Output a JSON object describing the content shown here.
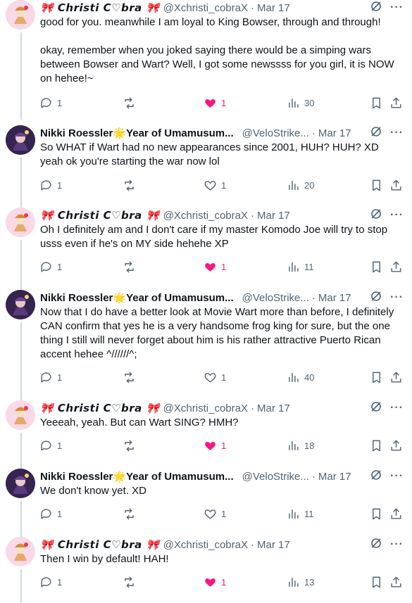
{
  "users": {
    "christi": {
      "name": "🎀 𝘾𝙝𝙧𝙞𝙨𝙩𝙞 𝘾♡𝙗𝙧𝙖 🎀",
      "handle": "@Xchristi_cobraX"
    },
    "nikki": {
      "name": "Nikki Roessler🌟Year of Umamusum...",
      "handle": "@VeloStrike..."
    }
  },
  "separator": "·",
  "tweets": [
    {
      "user": "christi",
      "date": "Mar 17",
      "text": "good for you. meanwhile I am loyal to King Bowser, through and through!\n\nokay, remember when you joked saying there would be a simping wars between Bowser and Wart? Well, I got some newssss for you girl, it is NOW on hehee!~",
      "replies": "1",
      "retweets": "",
      "likes": "1",
      "liked": true,
      "views": "30"
    },
    {
      "user": "nikki",
      "date": "Mar 17",
      "text": "So WHAT if Wart had no new appearances since 2001, HUH? HUH? XD\nyeah ok you're starting the war now lol",
      "replies": "1",
      "retweets": "",
      "likes": "1",
      "liked": false,
      "views": "20"
    },
    {
      "user": "christi",
      "date": "Mar 17",
      "text": "Oh I definitely am and I don't care if my master Komodo Joe will try to stop usss even if he's on MY side hehehe XP",
      "replies": "1",
      "retweets": "",
      "likes": "1",
      "liked": true,
      "views": "11"
    },
    {
      "user": "nikki",
      "date": "Mar 17",
      "text": "Now that I do have a better look at Movie Wart more than before, I definitely CAN confirm that yes he is a very handsome frog king for sure, but the one thing I still will never forget about him is his rather attractive Puerto Rican accent hehee ^//////^;",
      "replies": "1",
      "retweets": "",
      "likes": "1",
      "liked": false,
      "views": "40"
    },
    {
      "user": "christi",
      "date": "Mar 17",
      "text": "Yeeeah, yeah. But can Wart SING? HMH?",
      "replies": "1",
      "retweets": "",
      "likes": "1",
      "liked": true,
      "views": "18"
    },
    {
      "user": "nikki",
      "date": "Mar 17",
      "text": "We don't know yet. XD",
      "replies": "1",
      "retweets": "",
      "likes": "1",
      "liked": false,
      "views": "11"
    },
    {
      "user": "christi",
      "date": "Mar 17",
      "text": "Then I win by default! HAH!",
      "replies": "1",
      "retweets": "",
      "likes": "1",
      "liked": true,
      "views": "13"
    }
  ],
  "colors": {
    "like_active": "#f91880",
    "muted": "#536471",
    "text": "#0f1419"
  },
  "icons": {
    "reply": "reply-icon",
    "retweet": "retweet-icon",
    "like": "heart-icon",
    "views": "views-icon",
    "bookmark": "bookmark-icon",
    "share": "share-icon",
    "grok": "grok-icon",
    "more": "more-icon"
  }
}
